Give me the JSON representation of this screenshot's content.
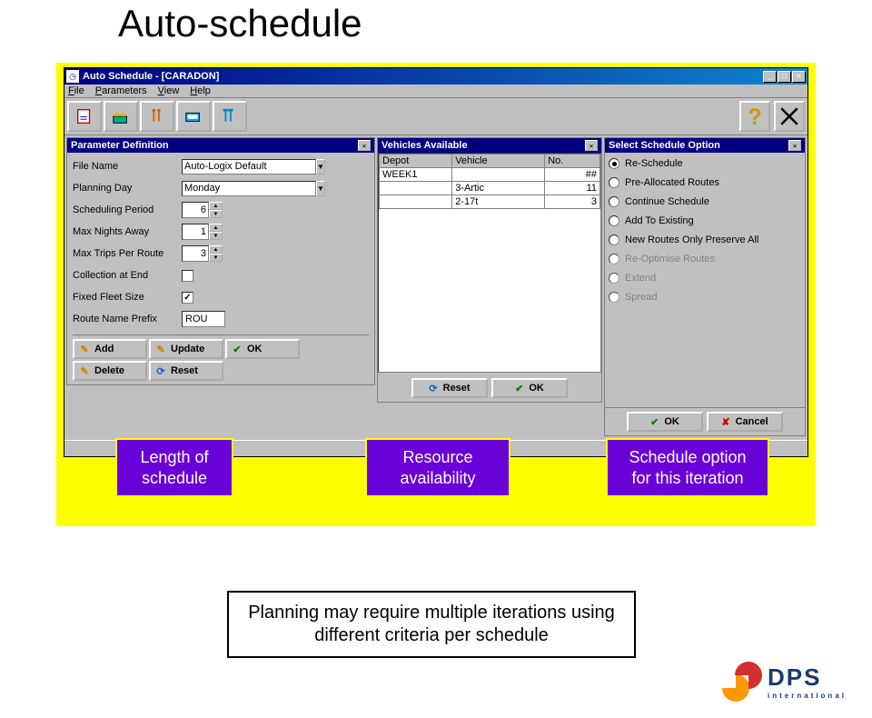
{
  "slide_title": "Auto-schedule",
  "titlebar": {
    "text": "Auto Schedule - [CARADON]"
  },
  "menu": {
    "file": "File",
    "parameters": "Parameters",
    "view": "View",
    "help": "Help"
  },
  "panel_param": {
    "title": "Parameter Definition",
    "labels": {
      "file_name": "File Name",
      "planning_day": "Planning Day",
      "sched_period": "Scheduling Period",
      "max_nights": "Max Nights Away",
      "max_trips": "Max Trips Per Route",
      "collection_end": "Collection at End",
      "fixed_fleet": "Fixed Fleet Size",
      "route_prefix": "Route Name Prefix"
    },
    "values": {
      "file_name": "Auto-Logix Default",
      "planning_day": "Monday",
      "sched_period": "6",
      "max_nights": "1",
      "max_trips": "3",
      "collection_end": "",
      "fixed_fleet": "✓",
      "route_prefix": "ROU"
    },
    "buttons": {
      "add": "Add",
      "update": "Update",
      "ok": "OK",
      "delete": "Delete",
      "reset": "Reset"
    }
  },
  "panel_vehicles": {
    "title": "Vehicles Available",
    "headers": {
      "depot": "Depot",
      "vehicle": "Vehicle",
      "no": "No."
    },
    "rows": [
      {
        "depot": "WEEK1",
        "vehicle": "",
        "no": "##"
      },
      {
        "depot": "",
        "vehicle": "3-Artic",
        "no": "11"
      },
      {
        "depot": "",
        "vehicle": "2-17t",
        "no": "3"
      }
    ],
    "buttons": {
      "reset": "Reset",
      "ok": "OK"
    }
  },
  "panel_options": {
    "title": "Select Schedule Option",
    "options": [
      {
        "label": "Re-Schedule",
        "checked": true,
        "disabled": false
      },
      {
        "label": "Pre-Allocated Routes",
        "checked": false,
        "disabled": false
      },
      {
        "label": "Continue Schedule",
        "checked": false,
        "disabled": false
      },
      {
        "label": "Add To Existing",
        "checked": false,
        "disabled": false
      },
      {
        "label": "New Routes Only Preserve All",
        "checked": false,
        "disabled": false
      },
      {
        "label": "Re-Optimise Routes",
        "checked": false,
        "disabled": true
      },
      {
        "label": "Extend",
        "checked": false,
        "disabled": true
      },
      {
        "label": "Spread",
        "checked": false,
        "disabled": true
      }
    ],
    "buttons": {
      "ok": "OK",
      "cancel": "Cancel"
    }
  },
  "callouts": {
    "c1": "Length of schedule",
    "c2": "Resource availability",
    "c3": "Schedule option for this iteration"
  },
  "note": "Planning may require multiple iterations using different criteria per schedule",
  "logo": {
    "name": "DPS",
    "sub": "international"
  }
}
